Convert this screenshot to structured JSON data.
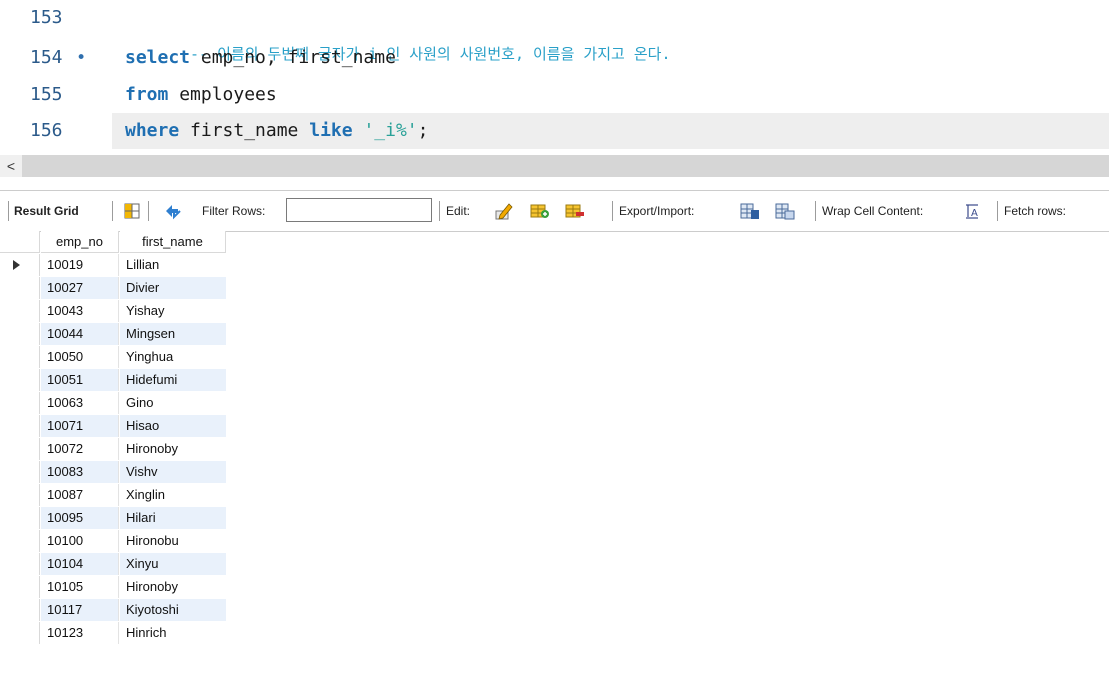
{
  "editor": {
    "lines": [
      {
        "number": "153",
        "marker": "",
        "comment": "-- 이름의 두번째 글자가 i 인 사원의 사원번호, 이름을 가지고 온다."
      },
      {
        "number": "154",
        "marker": "•",
        "kw1": "select",
        "rest": " emp_no, first_name"
      },
      {
        "number": "155",
        "marker": "",
        "kw1": "from",
        "rest": " employees"
      },
      {
        "number": "156",
        "marker": "",
        "kw1": "where",
        "mid": " first_name ",
        "kw2": "like",
        "sp": " ",
        "str": "'_i%'",
        "end": ";"
      }
    ]
  },
  "scroll": {
    "left_arrow": "<"
  },
  "toolbar": {
    "result_grid": "Result Grid",
    "filter_rows": "Filter Rows:",
    "filter_value": "",
    "edit": "Edit:",
    "export_import": "Export/Import:",
    "wrap_cell": "Wrap Cell Content:",
    "fetch_rows": "Fetch rows:"
  },
  "grid": {
    "columns": [
      "emp_no",
      "first_name"
    ],
    "rows": [
      [
        "10019",
        "Lillian"
      ],
      [
        "10027",
        "Divier"
      ],
      [
        "10043",
        "Yishay"
      ],
      [
        "10044",
        "Mingsen"
      ],
      [
        "10050",
        "Yinghua"
      ],
      [
        "10051",
        "Hidefumi"
      ],
      [
        "10063",
        "Gino"
      ],
      [
        "10071",
        "Hisao"
      ],
      [
        "10072",
        "Hironoby"
      ],
      [
        "10083",
        "Vishv"
      ],
      [
        "10087",
        "Xinglin"
      ],
      [
        "10095",
        "Hilari"
      ],
      [
        "10100",
        "Hironobu"
      ],
      [
        "10104",
        "Xinyu"
      ],
      [
        "10105",
        "Hironoby"
      ],
      [
        "10117",
        "Kiyotoshi"
      ],
      [
        "10123",
        "Hinrich"
      ]
    ]
  }
}
